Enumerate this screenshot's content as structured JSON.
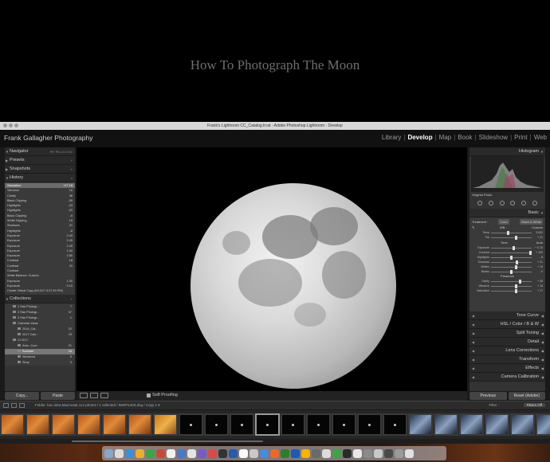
{
  "hero_title": "How To Photograph The Moon",
  "window_title": "Frank's Lightroom CC_Catalog.lrcat - Adobe Photoshop Lightroom - Develop",
  "identity_plate": "Frank Gallagher Photography",
  "modules": [
    "Library",
    "Develop",
    "Map",
    "Book",
    "Slideshow",
    "Print",
    "Web"
  ],
  "active_module": "Develop",
  "left_panel": {
    "navigator": "Navigator",
    "navigator_zoom": "FIT  FILL  1:1  3:1",
    "presets": "Presets",
    "snapshots": "Snapshots",
    "history": "History",
    "history_items": [
      {
        "label": "Saturation",
        "from": "+17",
        "to": "18"
      },
      {
        "label": "Vibrance",
        "from": "",
        "to": "16"
      },
      {
        "label": "Clarity",
        "from": "",
        "to": "36"
      },
      {
        "label": "Black Clipping",
        "from": "",
        "to": "-39"
      },
      {
        "label": "Highlights",
        "from": "",
        "to": "-23"
      },
      {
        "label": "Highlights",
        "from": "",
        "to": "-20"
      },
      {
        "label": "Black Clipping",
        "from": "",
        "to": "-5"
      },
      {
        "label": "White Clipping",
        "from": "",
        "to": "19"
      },
      {
        "label": "Shadows",
        "from": "",
        "to": "21"
      },
      {
        "label": "Highlights",
        "from": "",
        "to": "-8"
      },
      {
        "label": "Exposure",
        "from": "",
        "to": "2.40"
      },
      {
        "label": "Exposure",
        "from": "",
        "to": "2.45"
      },
      {
        "label": "Exposure",
        "from": "",
        "to": "2.45"
      },
      {
        "label": "Exposure",
        "from": "",
        "to": "2.40"
      },
      {
        "label": "Exposure",
        "from": "",
        "to": "2.50"
      },
      {
        "label": "Contrast",
        "from": "",
        "to": "18"
      },
      {
        "label": "Contrast",
        "from": "",
        "to": "20"
      },
      {
        "label": "Contrast",
        "from": "",
        "to": ""
      },
      {
        "label": "White Balance: Custom",
        "from": "",
        "to": ""
      },
      {
        "label": "Exposure",
        "from": "",
        "to": "1.00"
      },
      {
        "label": "Exposure",
        "from": "",
        "to": "0.10"
      },
      {
        "label": "Create Virtual Copy (6/13/17 4:27:40 PM)",
        "from": "",
        "to": ""
      }
    ],
    "collections": "Collections",
    "collection_items": [
      {
        "label": "1 Star Photogr...",
        "count": "7"
      },
      {
        "label": "2 Star Photogr...",
        "count": "37"
      },
      {
        "label": "3 Star Photogr...",
        "count": "1"
      },
      {
        "label": "Calendar Ideas",
        "count": ""
      },
      {
        "label": "2016_Cal...",
        "count": "22"
      },
      {
        "label": "2017 Cale...",
        "count": "15"
      },
      {
        "label": "Ct 2017",
        "count": ""
      },
      {
        "label": "Artw...Com",
        "count": "21"
      },
      {
        "label": "Summer",
        "count": "18"
      },
      {
        "label": "Weekend",
        "count": "5"
      },
      {
        "label": "Story",
        "count": "3"
      }
    ],
    "copy_button": "Copy...",
    "paste_button": "Paste"
  },
  "toolbar": {
    "soft_proofing": "Soft Proofing"
  },
  "right_panel": {
    "histogram": "Histogram",
    "original_photo": "Original Photo",
    "basic": "Basic",
    "treatment": "Treatment :",
    "color": "Color",
    "bw": "Black & White",
    "wb": "WB :",
    "wb_value": "Custom",
    "tone": "Tone",
    "auto": "Auto",
    "presence": "Presence",
    "sliders_wb": [
      {
        "label": "Temp",
        "value": "3,500",
        "pos": 0.4
      },
      {
        "label": "Tint",
        "value": "+ 21",
        "pos": 0.58
      }
    ],
    "sliders_tone": [
      {
        "label": "Exposure",
        "value": "+ 0.10",
        "pos": 0.52
      },
      {
        "label": "Contrast",
        "value": "+ 100",
        "pos": 0.95
      },
      {
        "label": "Highlights",
        "value": "- 8",
        "pos": 0.47
      },
      {
        "label": "Shadows",
        "value": "+ 21",
        "pos": 0.6
      },
      {
        "label": "Whites",
        "value": "+ 19",
        "pos": 0.59
      },
      {
        "label": "Blacks",
        "value": "- 5",
        "pos": 0.48
      }
    ],
    "sliders_presence": [
      {
        "label": "Clarity",
        "value": "+ 36",
        "pos": 0.68
      },
      {
        "label": "Vibrance",
        "value": "+ 16",
        "pos": 0.58
      },
      {
        "label": "Saturation",
        "value": "+ 17",
        "pos": 0.58
      }
    ],
    "sections": [
      "Tone Curve",
      "HSL / Color / B & W",
      "Split Toning",
      "Detail",
      "Lens Corrections",
      "Transform",
      "Effects",
      "Camera Calibration"
    ],
    "previous_button": "Previous",
    "reset_button": "Reset (Adobe)"
  },
  "filmstrip": {
    "info": "Folder: box.intra.Macrostat   114 photos / 1 selected / IMGP1403.dng / Copy 1 ▾",
    "filter": "Filter :",
    "filter_off": "Filters Off"
  },
  "colors": {
    "accent": "#ffffff",
    "panel": "#333333",
    "panel_dark": "#2a2a2a",
    "background": "#000000"
  }
}
